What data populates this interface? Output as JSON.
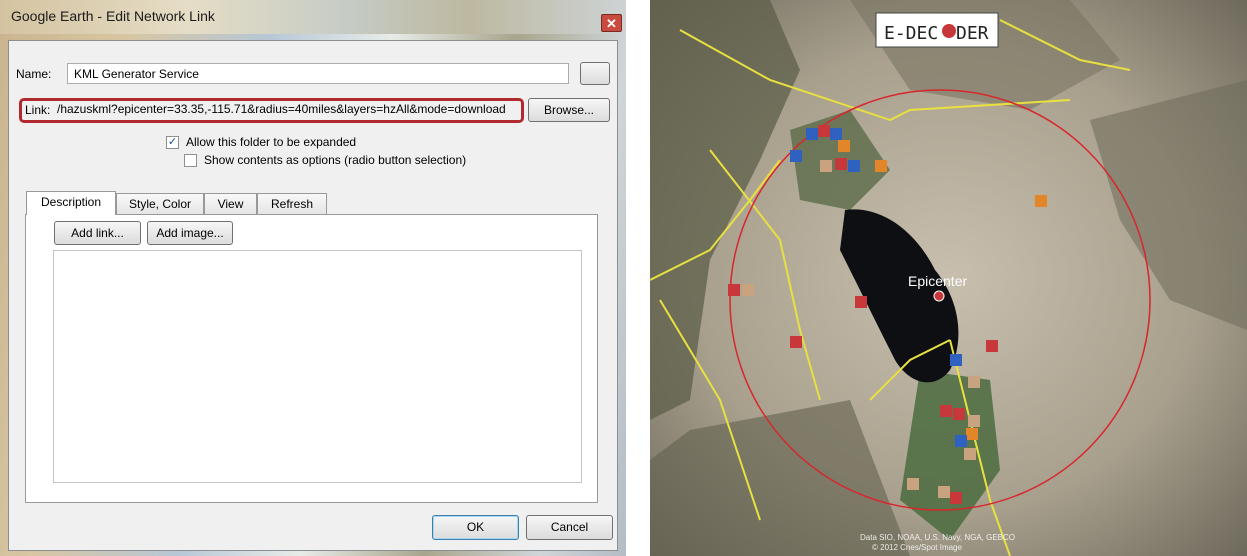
{
  "dialog": {
    "title": "Google Earth - Edit Network Link",
    "close_glyph": "✕",
    "name_label": "Name:",
    "name_value": "KML Generator Service",
    "link_label": "Link:",
    "link_value": "/hazuskml?epicenter=33.35,-115.71&radius=40miles&layers=hzAll&mode=download",
    "browse_label": "Browse...",
    "allow_expand_label": "Allow this folder to be expanded",
    "allow_expand_checked": true,
    "radio_label": "Show contents as options (radio button selection)",
    "radio_checked": false,
    "tabs": [
      {
        "label": "Description",
        "active": true
      },
      {
        "label": "Style, Color",
        "active": false
      },
      {
        "label": "View",
        "active": false
      },
      {
        "label": "Refresh",
        "active": false
      }
    ],
    "add_link_label": "Add link...",
    "add_image_label": "Add image...",
    "ok_label": "OK",
    "cancel_label": "Cancel"
  },
  "map": {
    "logo_text_left": "E-DEC",
    "logo_text_right": "DER",
    "epicenter_label": "Epicenter",
    "attribution_line1": "Data SIO, NOAA, U.S. Navy, NGA, GEBCO",
    "attribution_line2": "© 2012 Cnes/Spot Image",
    "colors": {
      "radius_circle": "#d8262b",
      "fault_lines": "#e8e040",
      "marker_red": "#c8373a",
      "marker_blue": "#2f62c0",
      "marker_orange": "#e3862a",
      "marker_tan": "#c9a27f"
    }
  }
}
